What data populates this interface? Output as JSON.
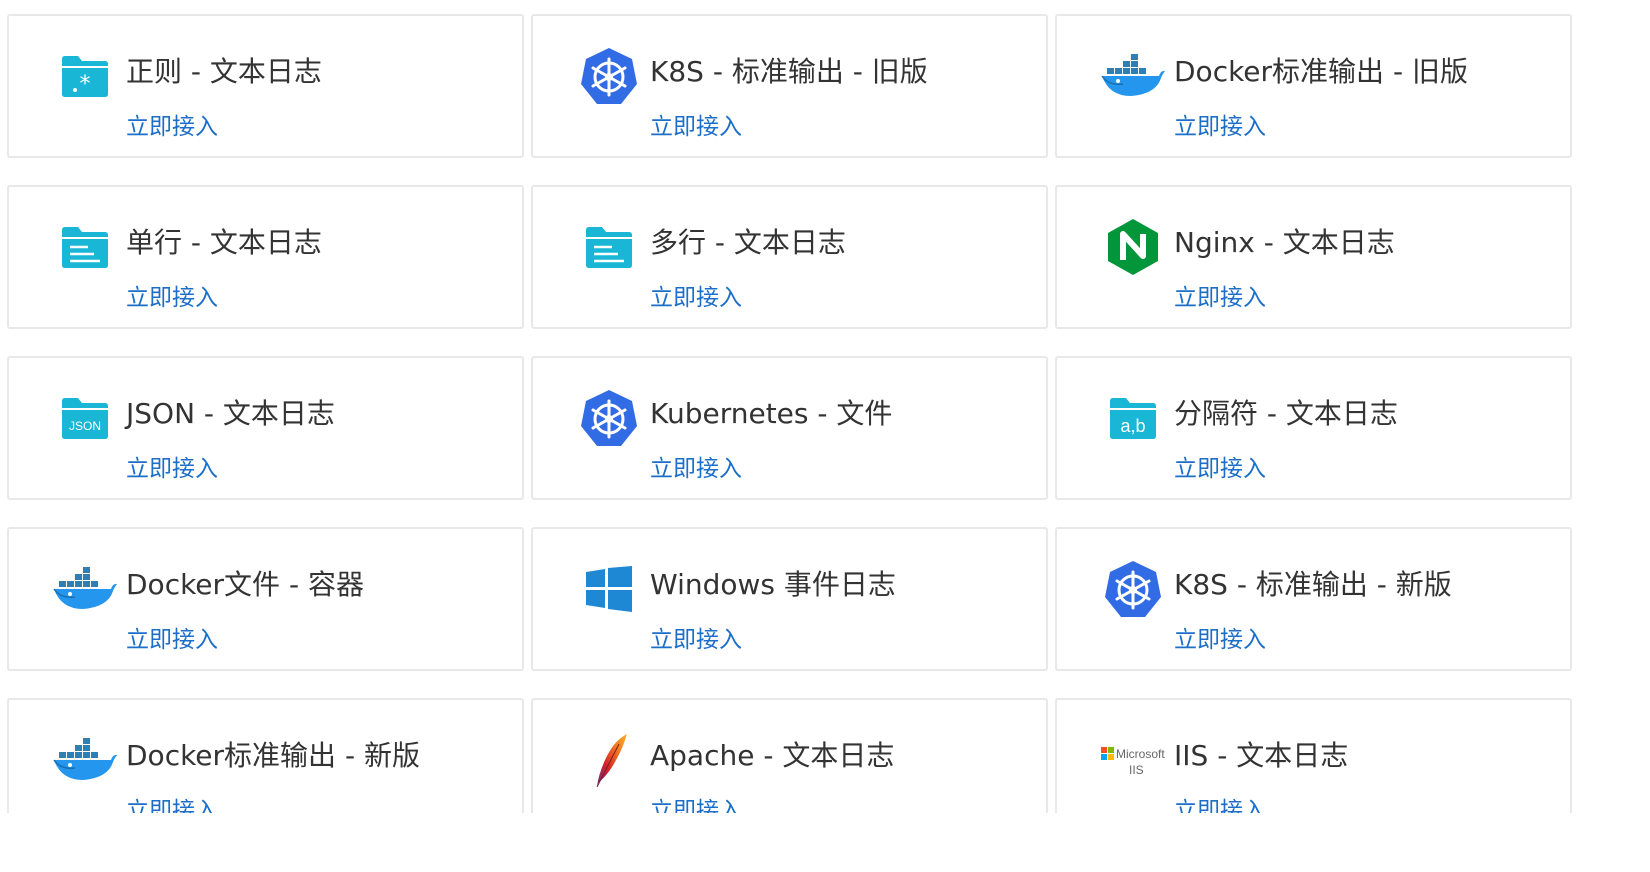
{
  "colors": {
    "link": "#1c6ec9",
    "title": "#333333",
    "border": "#e8e8e8",
    "folder": "#1ab6d6",
    "kubernetes": "#326ce5",
    "nginx": "#009639",
    "docker": "#2496ed",
    "windows": "#1e88d4"
  },
  "cards": [
    {
      "title": "正则 - 文本日志",
      "link": "立即接入",
      "icon": "regex-folder-icon"
    },
    {
      "title": "K8S - 标准输出 - 旧版",
      "link": "立即接入",
      "icon": "kubernetes-icon"
    },
    {
      "title": "Docker标准输出 - 旧版",
      "link": "立即接入",
      "icon": "docker-icon"
    },
    {
      "title": "单行 - 文本日志",
      "link": "立即接入",
      "icon": "single-line-folder-icon"
    },
    {
      "title": "多行 - 文本日志",
      "link": "立即接入",
      "icon": "multi-line-folder-icon"
    },
    {
      "title": "Nginx - 文本日志",
      "link": "立即接入",
      "icon": "nginx-icon"
    },
    {
      "title": "JSON - 文本日志",
      "link": "立即接入",
      "icon": "json-folder-icon",
      "icon_text": "JSON"
    },
    {
      "title": "Kubernetes - 文件",
      "link": "立即接入",
      "icon": "kubernetes-icon"
    },
    {
      "title": "分隔符 - 文本日志",
      "link": "立即接入",
      "icon": "delimiter-folder-icon",
      "icon_text": "a,b"
    },
    {
      "title": "Docker文件 - 容器",
      "link": "立即接入",
      "icon": "docker-icon"
    },
    {
      "title": "Windows 事件日志",
      "link": "立即接入",
      "icon": "windows-icon"
    },
    {
      "title": "K8S - 标准输出 - 新版",
      "link": "立即接入",
      "icon": "kubernetes-icon"
    },
    {
      "title": "Docker标准输出 - 新版",
      "link": "立即接入",
      "icon": "docker-icon"
    },
    {
      "title": "Apache - 文本日志",
      "link": "立即接入",
      "icon": "apache-feather-icon"
    },
    {
      "title": "IIS - 文本日志",
      "link": "立即接入",
      "icon": "microsoft-iis-icon",
      "icon_text": [
        "Microsoft",
        "IIS"
      ]
    }
  ]
}
